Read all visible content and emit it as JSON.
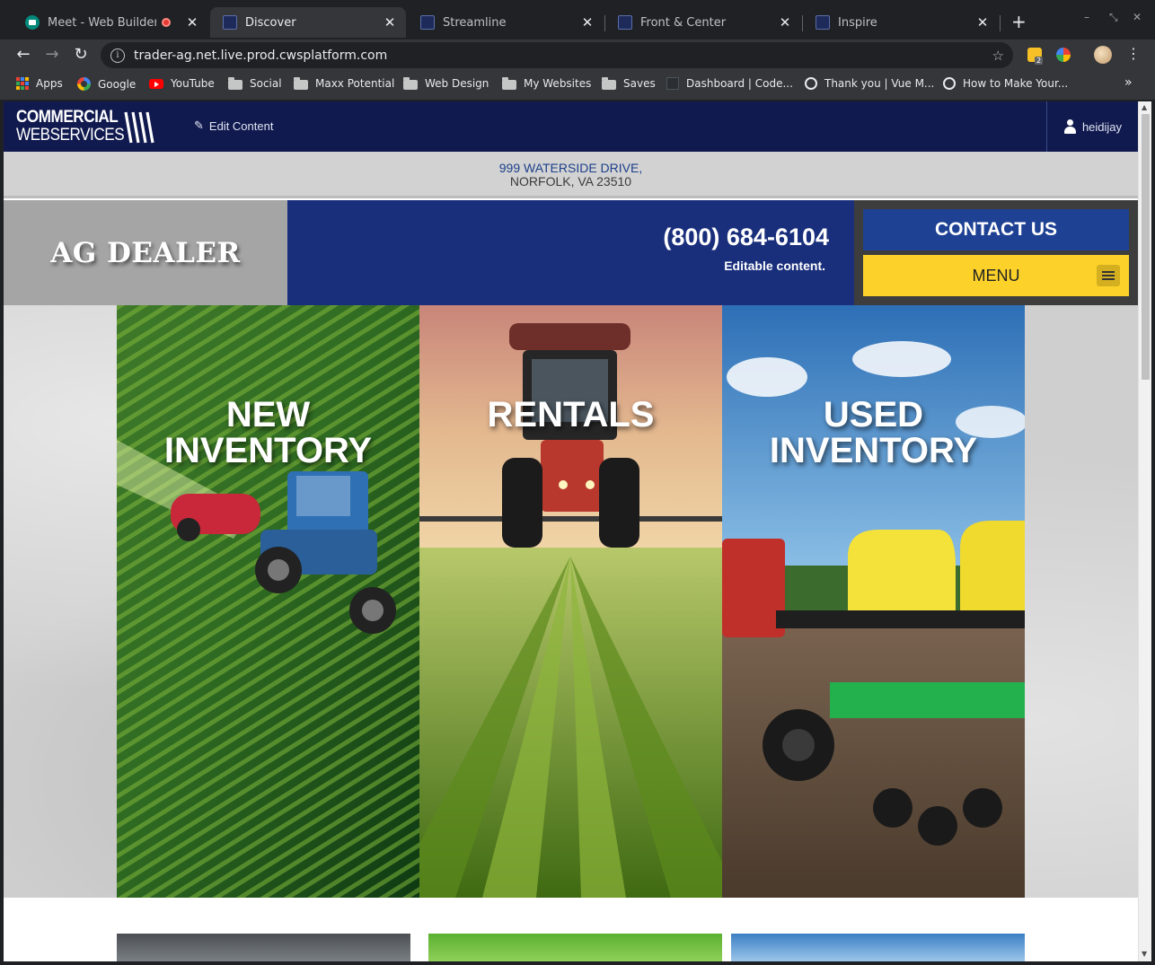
{
  "browser": {
    "tabs": [
      {
        "title": "Meet - Web Builder Offic",
        "active": false,
        "favicon": "meet-icon",
        "recording": true
      },
      {
        "title": "Discover",
        "active": true,
        "favicon": "cws-icon"
      },
      {
        "title": "Streamline",
        "active": false,
        "favicon": "cws-icon"
      },
      {
        "title": "Front & Center",
        "active": false,
        "favicon": "cws-icon"
      },
      {
        "title": "Inspire",
        "active": false,
        "favicon": "cws-icon"
      }
    ],
    "url": "trader-ag.net.live.prod.cwsplatform.com",
    "extension_badge": "2",
    "bookmarks": [
      {
        "label": "Apps",
        "icon": "apps-grid-icon"
      },
      {
        "label": "Google",
        "icon": "google-icon"
      },
      {
        "label": "YouTube",
        "icon": "youtube-icon"
      },
      {
        "label": "Social",
        "icon": "folder-icon"
      },
      {
        "label": "Maxx Potential",
        "icon": "folder-icon"
      },
      {
        "label": "Web Design",
        "icon": "folder-icon"
      },
      {
        "label": "My Websites",
        "icon": "folder-icon"
      },
      {
        "label": "Saves",
        "icon": "folder-icon"
      },
      {
        "label": "Dashboard | Code...",
        "icon": "code-icon"
      },
      {
        "label": "Thank you | Vue M...",
        "icon": "globe-icon"
      },
      {
        "label": "How to Make Your...",
        "icon": "globe-icon"
      }
    ]
  },
  "admin": {
    "logo_line1": "COMMERCIAL",
    "logo_line2": "WEBSERVICES",
    "edit_label": "Edit Content",
    "username": "heidijay"
  },
  "site": {
    "address_street": "999 WATERSIDE DRIVE,",
    "address_city": "NORFOLK, VA 23510",
    "brand": "AG DEALER",
    "phone": "(800) 684-6104",
    "phone_note": "Editable content.",
    "contact_label": "CONTACT US",
    "menu_label": "MENU"
  },
  "hero": {
    "panels": [
      {
        "line1": "NEW",
        "line2": "INVENTORY"
      },
      {
        "line1": "RENTALS",
        "line2": ""
      },
      {
        "line1": "USED",
        "line2": "INVENTORY"
      }
    ]
  },
  "colors": {
    "admin_bg": "#111a4f",
    "brand_blue": "#1a2f7c",
    "contact_blue": "#1e4194",
    "menu_yellow": "#fcd22a"
  }
}
